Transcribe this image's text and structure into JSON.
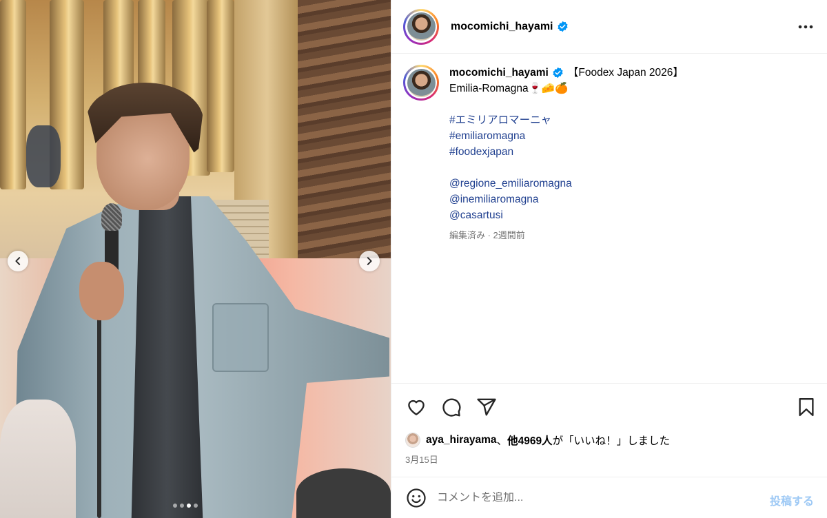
{
  "post": {
    "username": "mocomichi_hayami",
    "verified": true,
    "caption": {
      "title": "【Foodex Japan 2026】",
      "line2": "Emilia-Romagna🍷🧀🍊",
      "hashtags": [
        "#エミリアロマーニャ",
        "#emiliaromagna",
        "#foodexjapan"
      ],
      "mentions": [
        "@regione_emiliaromagna",
        "@inemiliaromagna",
        "@casartusi"
      ],
      "meta": "編集済み · 2週間前"
    },
    "likes": {
      "user": "aya_hirayama",
      "text_sep": "、",
      "others": "他4969人",
      "suffix": "が「いいね！」しました"
    },
    "date": "3月15日"
  },
  "media": {
    "slide_count": 4,
    "active_slide": 3
  },
  "comment": {
    "placeholder": "コメントを追加...",
    "post_label": "投稿する"
  },
  "colors": {
    "verified": "#0095f6",
    "link": "#1f3f8f",
    "post_button_disabled": "#9ec9f5",
    "muted": "#737373"
  },
  "icons": [
    "chevron-left-icon",
    "chevron-right-icon",
    "verified-badge-icon",
    "more-icon",
    "heart-icon",
    "comment-icon",
    "share-icon",
    "bookmark-icon",
    "emoji-icon"
  ]
}
